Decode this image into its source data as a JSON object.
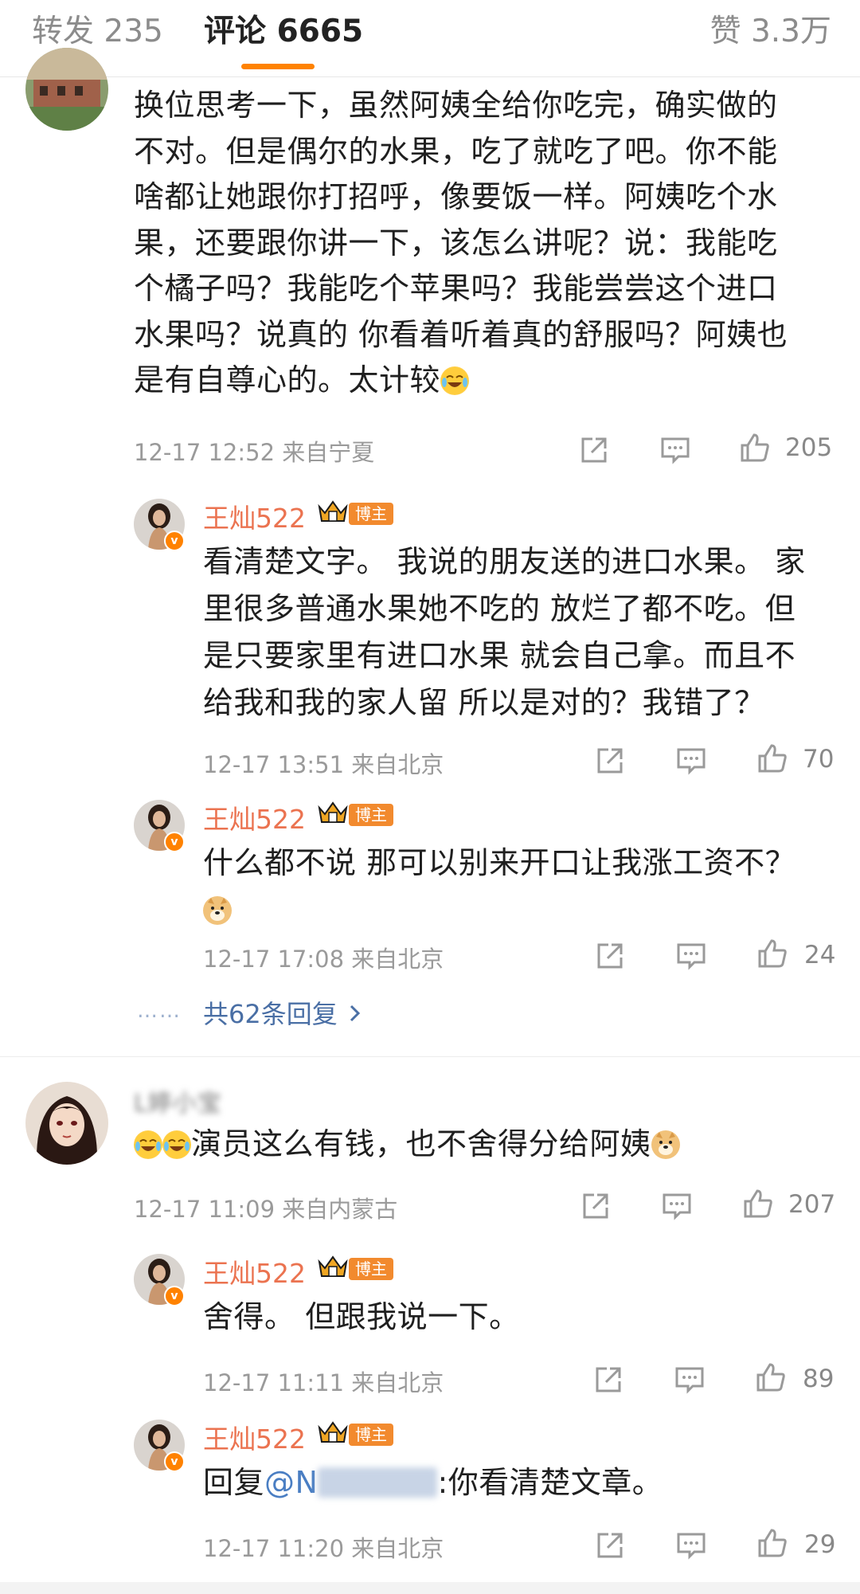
{
  "tabs": {
    "repost": "转发 235",
    "comments": "评论 6665",
    "likes": "赞 3.3万"
  },
  "colors": {
    "accent": "#ff8200",
    "username": "#eb7350",
    "link": "#4a6fa5"
  },
  "comment1": {
    "lines": [
      "换位思考一下，虽然阿姨全给你吃完，确实做的",
      "不对。但是偶尔的水果，吃了就吃了吧。你不能",
      "啥都让她跟你打招呼，像要饭一样。阿姨吃个水",
      "果，还要跟你讲一下，该怎么讲呢？说：我能吃",
      "个橘子吗？我能吃个苹果吗？我能尝尝这个进口",
      "水果吗？说真的 你看着听着真的舒服吗？阿姨也",
      "是有自尊心的。太计较"
    ],
    "meta": "12-17 12:52  来自宁夏",
    "likes": "205",
    "replies": [
      {
        "user": "王灿522",
        "badge": "博主",
        "lines": [
          "看清楚文字。 我说的朋友送的进口水果。 家",
          "里很多普通水果她不吃的 放烂了都不吃。但",
          "是只要家里有进口水果 就会自己拿。而且不",
          "给我和我的家人留 所以是对的？我错了？"
        ],
        "meta": "12-17 13:51  来自北京",
        "likes": "70"
      },
      {
        "user": "王灿522",
        "badge": "博主",
        "lines": [
          "什么都不说 那可以别来开口让我涨工资不？"
        ],
        "meta": "12-17 17:08  来自北京",
        "likes": "24"
      }
    ],
    "more": "共62条回复",
    "more_dots": "……"
  },
  "comment2": {
    "user": "L婷小宝",
    "text": "演员这么有钱，也不舍得分给阿姨",
    "meta": "12-17 11:09  来自内蒙古",
    "likes": "207",
    "replies": [
      {
        "user": "王灿522",
        "badge": "博主",
        "text": "舍得。 但跟我说一下。",
        "meta": "12-17 11:11  来自北京",
        "likes": "89"
      },
      {
        "user": "王灿522",
        "badge": "博主",
        "text_prefix": "回复",
        "mention": "@N",
        "text_suffix": ":你看清楚文章。",
        "meta": "12-17 11:20  来自北京",
        "likes": "29"
      }
    ]
  }
}
